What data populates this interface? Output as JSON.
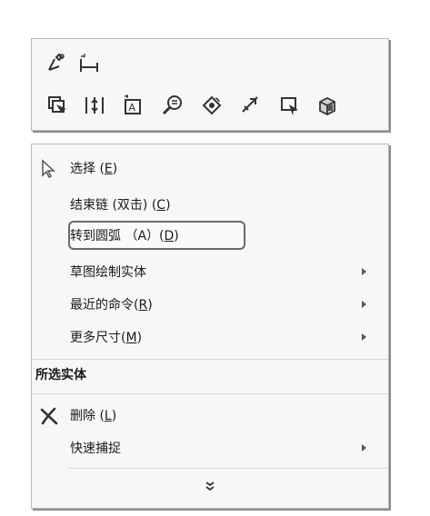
{
  "toolbar": {
    "row1": [
      {
        "name": "smart-dimension-icon"
      },
      {
        "name": "horizontal-dimension-icon"
      }
    ],
    "row2": [
      {
        "name": "select-other-icon"
      },
      {
        "name": "mirror-entities-icon"
      },
      {
        "name": "insert-note-icon"
      },
      {
        "name": "zoom-to-selection-icon"
      },
      {
        "name": "view-orientation-icon"
      },
      {
        "name": "relation-icon"
      },
      {
        "name": "move-entities-icon"
      },
      {
        "name": "display-style-icon"
      }
    ]
  },
  "menu": {
    "items": [
      {
        "label_main": "选择 (",
        "key": "E",
        "label_tail": ")"
      },
      {
        "label_main": "结束链 (双击) (",
        "key": "C",
        "label_tail": ")"
      },
      {
        "label_main": "转到圆弧 （A）(",
        "key": "D",
        "label_tail": ")"
      },
      {
        "label_main": "草图绘制实体",
        "submenu": true
      },
      {
        "label_main": "最近的命令(",
        "key": "R",
        "label_tail": ")",
        "submenu": true
      },
      {
        "label_main": "更多尺寸(",
        "key": "M",
        "label_tail": ")",
        "submenu": true
      }
    ],
    "section_header": "所选实体",
    "section_items": [
      {
        "label_main": "删除 (",
        "key": "L",
        "label_tail": ")"
      },
      {
        "label_main": "快速捕捉",
        "submenu": true
      }
    ],
    "expand_icon": "double-chevron-down-icon"
  },
  "colors": {
    "panel_bg": "#f7f7f7",
    "panel_border": "#b9b9b9",
    "highlight_border": "#6a6a6a"
  }
}
